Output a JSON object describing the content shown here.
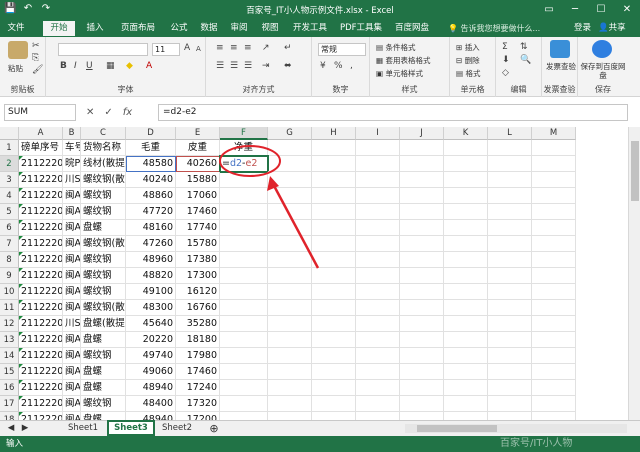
{
  "title": "百家号_IT小人物示例文件.xlsx - Excel",
  "tabs": [
    "文件",
    "开始",
    "插入",
    "页面布局",
    "公式",
    "数据",
    "审阅",
    "视图",
    "开发工具",
    "PDF工具集",
    "百度网盘"
  ],
  "active_tab": "开始",
  "tell_me": "告诉我您想要做什么...",
  "account": {
    "login": "登录",
    "share": "共享"
  },
  "ribbon": {
    "paste": "粘贴",
    "clipboard": "剪贴板",
    "font_group": "字体",
    "font_size": "11",
    "align_group": "对齐方式",
    "number_format": "常规",
    "number_group": "数字",
    "cond_format": "条件格式",
    "table_format": "套用表格格式",
    "cell_style": "单元格样式",
    "style_group": "样式",
    "insert": "插入",
    "delete": "删除",
    "format": "格式",
    "cells_group": "单元格",
    "editing_group": "编辑",
    "invoice_check": "发票查验",
    "invoice_group": "发票查验",
    "save_to": "保存到百度网盘",
    "save_group": "保存"
  },
  "name_box": "SUM",
  "formula": "=d2-e2",
  "columns": [
    "A",
    "B",
    "C",
    "D",
    "E",
    "F",
    "G",
    "H",
    "I",
    "J",
    "K",
    "L",
    "M"
  ],
  "headers": [
    "磅单序号",
    "车号",
    "货物名称",
    "毛重",
    "皮重",
    "净重"
  ],
  "rows": [
    [
      "21122201C",
      "晥P(",
      "线材(散提",
      48580,
      40260,
      "=d2-e2"
    ],
    [
      "21122201C",
      "川S(",
      "螺纹钢(散",
      40240,
      15880,
      ""
    ],
    [
      "21122201C",
      "闽A",
      "螺纹钢",
      48860,
      17060,
      ""
    ],
    [
      "21122201C",
      "闽A",
      "螺纹钢",
      47720,
      17460,
      ""
    ],
    [
      "21122201C",
      "闽A",
      "盘螺",
      48160,
      17740,
      ""
    ],
    [
      "21122201C",
      "闽A",
      "螺纹钢(散",
      47260,
      15780,
      ""
    ],
    [
      "21122201C",
      "闽A",
      "螺纹钢",
      48960,
      17380,
      ""
    ],
    [
      "21122201C",
      "闽A",
      "螺纹钢",
      48820,
      17300,
      ""
    ],
    [
      "21122201C",
      "闽A",
      "螺纹钢",
      49100,
      16120,
      ""
    ],
    [
      "21122201C",
      "闽A",
      "螺纹钢(散拒",
      48300,
      16760,
      ""
    ],
    [
      "21122201C",
      "川S(",
      "盘螺(散提-",
      45640,
      35280,
      ""
    ],
    [
      "21122201C",
      "闽A",
      "盘螺",
      20220,
      18180,
      ""
    ],
    [
      "21122201C",
      "闽A",
      "螺纹钢",
      49740,
      17980,
      ""
    ],
    [
      "21122201C",
      "闽A",
      "盘螺",
      49060,
      17460,
      ""
    ],
    [
      "21122201C",
      "闽A",
      "盘螺",
      48940,
      17240,
      ""
    ],
    [
      "21122201C",
      "闽A",
      "螺纹钢",
      48400,
      17320,
      ""
    ],
    [
      "21122201C",
      "闽A",
      "盘螺",
      48940,
      17200,
      ""
    ],
    [
      "21122201C",
      "闽A",
      "螺纹钢",
      48880,
      17600,
      ""
    ]
  ],
  "sheets": [
    "Sheet1",
    "Sheet3",
    "Sheet2"
  ],
  "active_sheet": "Sheet3",
  "status": "输入",
  "watermark": "百家号/IT小人物",
  "colors": {
    "accent": "#217346",
    "annotation": "#e0232b"
  }
}
